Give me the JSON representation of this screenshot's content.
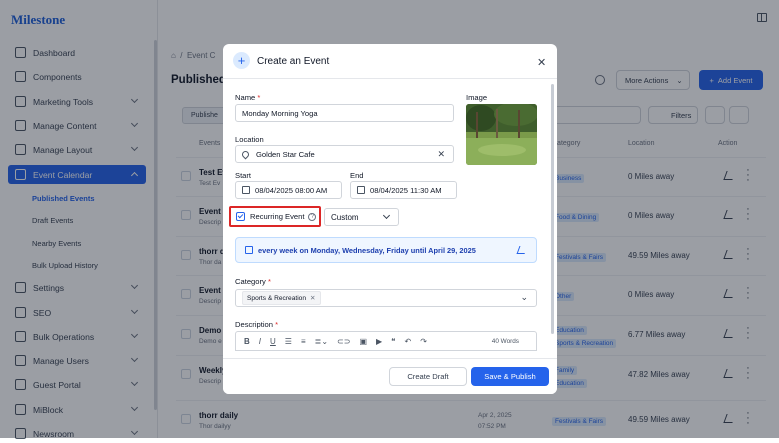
{
  "app": {
    "brand": "Milestone"
  },
  "sidebar": {
    "items": [
      {
        "label": "Dashboard",
        "icon": "dashboard-icon"
      },
      {
        "label": "Components",
        "icon": "layers-icon"
      },
      {
        "label": "Marketing Tools",
        "icon": "chart-icon"
      },
      {
        "label": "Manage Content",
        "icon": "document-icon"
      },
      {
        "label": "Manage Layout",
        "icon": "layout-icon"
      },
      {
        "label": "Event Calendar",
        "icon": "calendar-icon"
      },
      {
        "label": "Settings",
        "icon": "gear-icon"
      },
      {
        "label": "SEO",
        "icon": "globe-icon"
      },
      {
        "label": "Bulk Operations",
        "icon": "bulk-icon"
      },
      {
        "label": "Manage Users",
        "icon": "users-icon"
      },
      {
        "label": "Guest Portal",
        "icon": "portal-icon"
      },
      {
        "label": "MiBlock",
        "icon": "block-icon"
      },
      {
        "label": "Newsroom",
        "icon": "news-icon"
      }
    ],
    "subitems": [
      "Published Events",
      "Draft Events",
      "Nearby Events",
      "Bulk Upload History"
    ]
  },
  "header": {
    "breadcrumb": "Event C",
    "title": "Published E",
    "more_actions": "More Actions",
    "add_event": "Add Event",
    "published_tab": "Publishe",
    "filters": "Filters"
  },
  "table": {
    "headers": {
      "events": "Events",
      "category": "Category",
      "location": "Location",
      "action": "Action"
    },
    "rows": [
      {
        "title": "Test Ev",
        "desc": "Test Ev",
        "categories": [
          "Business"
        ],
        "location": "0 Miles away"
      },
      {
        "title": "Event C",
        "desc": "Descrip",
        "categories": [
          "Food & Dining"
        ],
        "location": "0 Miles away"
      },
      {
        "title": "thorr d",
        "desc": "Thor da",
        "categories": [
          "Festivals & Fairs"
        ],
        "location": "49.59 Miles away"
      },
      {
        "title": "Event C",
        "desc": "Descrip",
        "categories": [
          "Other"
        ],
        "location": "0 Miles away"
      },
      {
        "title": "Demo 2",
        "desc": "Demo e",
        "categories": [
          "Education",
          "Sports & Recreation"
        ],
        "location": "6.77 Miles away"
      },
      {
        "title": "Weekly",
        "desc": "Descrip",
        "categories": [
          "Family",
          "Education"
        ],
        "location": "47.82 Miles away"
      },
      {
        "title": "thorr daily",
        "desc": "Thor dailyy",
        "date": "Apr 2, 2025",
        "time": "07:52 PM",
        "categories": [
          "Festivals & Fairs"
        ],
        "location": "49.59 Miles away"
      }
    ]
  },
  "modal": {
    "title": "Create an Event",
    "name_label": "Name",
    "name_value": "Monday Morning Yoga",
    "image_label": "Image",
    "location_label": "Location",
    "location_value": "Golden Star Cafe",
    "start_label": "Start",
    "start_value": "08/04/2025 08:00 AM",
    "end_label": "End",
    "end_value": "08/04/2025 11:30 AM",
    "recurring_label": "Recurring Event",
    "recurrence_select": "Custom",
    "recurrence_summary": "every week on Monday, Wednesday, Friday until April 29, 2025",
    "category_label": "Category",
    "category_tag": "Sports & Recreation",
    "description_label": "Description",
    "word_count": "40 Words",
    "create_draft": "Create Draft",
    "save_publish": "Save & Publish",
    "required_mark": "*"
  },
  "colors": {
    "accent": "#2563eb",
    "highlight": "#dc2626"
  }
}
